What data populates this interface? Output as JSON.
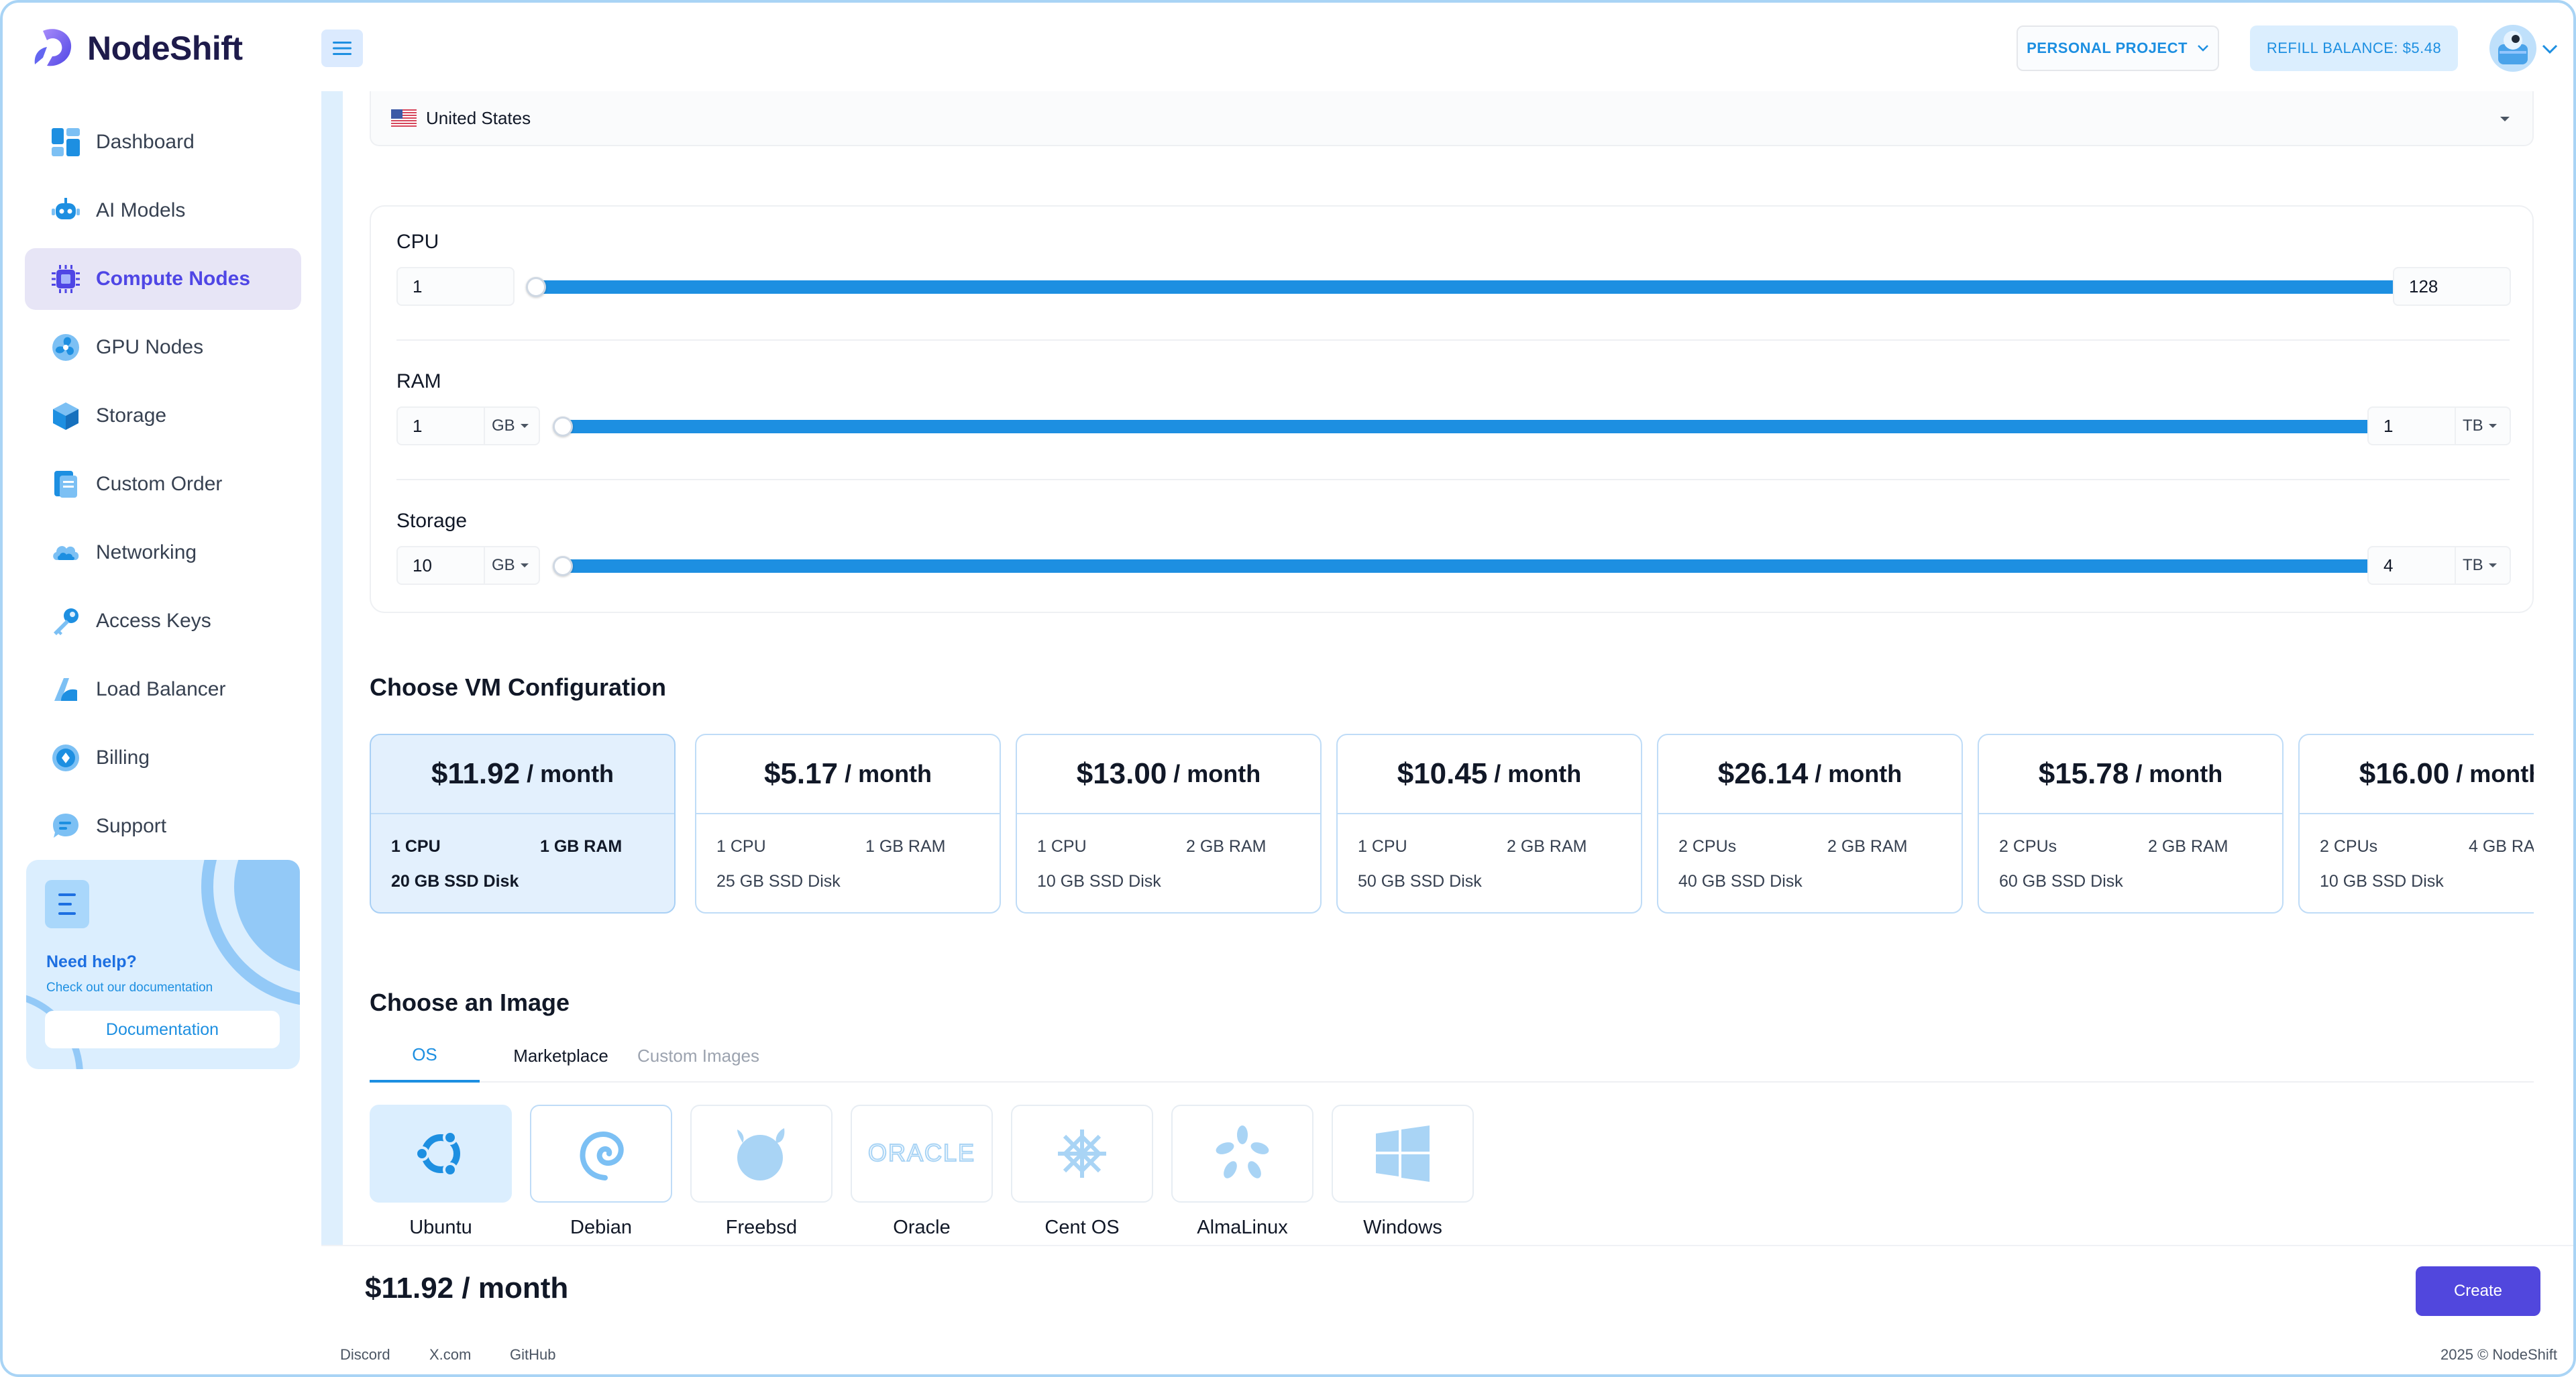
{
  "brand": {
    "name": "NodeShift"
  },
  "header": {
    "project_label": "PERSONAL PROJECT",
    "refill_label": "REFILL BALANCE: $5.48"
  },
  "sidebar": {
    "items": [
      {
        "label": "Dashboard",
        "icon": "dashboard-icon"
      },
      {
        "label": "AI Models",
        "icon": "robot-icon"
      },
      {
        "label": "Compute Nodes",
        "icon": "chip-icon",
        "active": true
      },
      {
        "label": "GPU Nodes",
        "icon": "gpu-fan-icon"
      },
      {
        "label": "Storage",
        "icon": "cube-icon"
      },
      {
        "label": "Custom Order",
        "icon": "document-icon"
      },
      {
        "label": "Networking",
        "icon": "cloud-icon"
      },
      {
        "label": "Access Keys",
        "icon": "key-icon"
      },
      {
        "label": "Load Balancer",
        "icon": "balancer-icon"
      },
      {
        "label": "Billing",
        "icon": "billing-icon"
      },
      {
        "label": "Support",
        "icon": "chat-icon"
      }
    ],
    "help": {
      "title": "Need help?",
      "subtitle": "Check out our documentation",
      "button": "Documentation"
    }
  },
  "location": {
    "value": "United States"
  },
  "resources": {
    "cpu": {
      "label": "CPU",
      "min": "1",
      "max": "128"
    },
    "ram": {
      "label": "RAM",
      "min": "1",
      "min_unit": "GB",
      "max": "1",
      "max_unit": "TB"
    },
    "storage": {
      "label": "Storage",
      "min": "10",
      "min_unit": "GB",
      "max": "4",
      "max_unit": "TB"
    }
  },
  "vm_config": {
    "title": "Choose VM Configuration",
    "per": "/ month",
    "cards": [
      {
        "price": "$11.92",
        "cpu": "1 CPU",
        "ram": "1 GB RAM",
        "disk": "20 GB SSD Disk",
        "selected": true
      },
      {
        "price": "$5.17",
        "cpu": "1 CPU",
        "ram": "1 GB RAM",
        "disk": "25 GB SSD Disk"
      },
      {
        "price": "$13.00",
        "cpu": "1 CPU",
        "ram": "2 GB RAM",
        "disk": "10 GB SSD Disk"
      },
      {
        "price": "$10.45",
        "cpu": "1 CPU",
        "ram": "2 GB RAM",
        "disk": "50 GB SSD Disk"
      },
      {
        "price": "$26.14",
        "cpu": "2 CPUs",
        "ram": "2 GB RAM",
        "disk": "40 GB SSD Disk"
      },
      {
        "price": "$15.78",
        "cpu": "2 CPUs",
        "ram": "2 GB RAM",
        "disk": "60 GB SSD Disk"
      },
      {
        "price": "$16.00",
        "cpu": "2 CPUs",
        "ram": "4 GB RAM",
        "disk": "10 GB SSD Disk"
      }
    ]
  },
  "image": {
    "title": "Choose an Image",
    "tabs": [
      "OS",
      "Marketplace",
      "Custom Images"
    ],
    "os": [
      {
        "label": "Ubuntu",
        "icon": "ubuntu-icon"
      },
      {
        "label": "Debian",
        "icon": "debian-icon"
      },
      {
        "label": "Freebsd",
        "icon": "freebsd-icon"
      },
      {
        "label": "Oracle",
        "icon": "oracle-icon"
      },
      {
        "label": "Cent OS",
        "icon": "centos-icon"
      },
      {
        "label": "AlmaLinux",
        "icon": "almalinux-icon"
      },
      {
        "label": "Windows",
        "icon": "windows-icon"
      }
    ]
  },
  "bottom": {
    "total": "$11.92 / month",
    "create_label": "Create"
  },
  "footer": {
    "links": [
      "Discord",
      "X.com",
      "GitHub"
    ],
    "copyright": "2025 © NodeShift"
  },
  "colors": {
    "accent": "#1d8fe1",
    "brand": "#5147dd",
    "active_nav_bg": "#e7e5f6",
    "light_blue": "#dbeefe"
  }
}
